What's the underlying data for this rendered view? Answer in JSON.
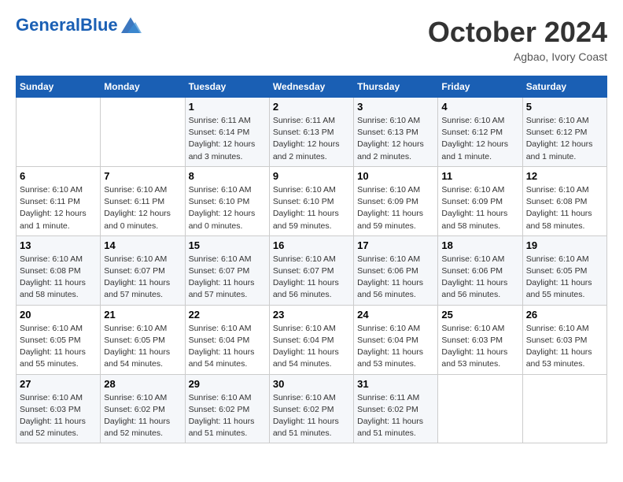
{
  "header": {
    "logo_general": "General",
    "logo_blue": "Blue",
    "month_title": "October 2024",
    "location": "Agbao, Ivory Coast"
  },
  "weekdays": [
    "Sunday",
    "Monday",
    "Tuesday",
    "Wednesday",
    "Thursday",
    "Friday",
    "Saturday"
  ],
  "weeks": [
    [
      {
        "day": "",
        "info": ""
      },
      {
        "day": "",
        "info": ""
      },
      {
        "day": "1",
        "info": "Sunrise: 6:11 AM\nSunset: 6:14 PM\nDaylight: 12 hours and 3 minutes."
      },
      {
        "day": "2",
        "info": "Sunrise: 6:11 AM\nSunset: 6:13 PM\nDaylight: 12 hours and 2 minutes."
      },
      {
        "day": "3",
        "info": "Sunrise: 6:10 AM\nSunset: 6:13 PM\nDaylight: 12 hours and 2 minutes."
      },
      {
        "day": "4",
        "info": "Sunrise: 6:10 AM\nSunset: 6:12 PM\nDaylight: 12 hours and 1 minute."
      },
      {
        "day": "5",
        "info": "Sunrise: 6:10 AM\nSunset: 6:12 PM\nDaylight: 12 hours and 1 minute."
      }
    ],
    [
      {
        "day": "6",
        "info": "Sunrise: 6:10 AM\nSunset: 6:11 PM\nDaylight: 12 hours and 1 minute."
      },
      {
        "day": "7",
        "info": "Sunrise: 6:10 AM\nSunset: 6:11 PM\nDaylight: 12 hours and 0 minutes."
      },
      {
        "day": "8",
        "info": "Sunrise: 6:10 AM\nSunset: 6:10 PM\nDaylight: 12 hours and 0 minutes."
      },
      {
        "day": "9",
        "info": "Sunrise: 6:10 AM\nSunset: 6:10 PM\nDaylight: 11 hours and 59 minutes."
      },
      {
        "day": "10",
        "info": "Sunrise: 6:10 AM\nSunset: 6:09 PM\nDaylight: 11 hours and 59 minutes."
      },
      {
        "day": "11",
        "info": "Sunrise: 6:10 AM\nSunset: 6:09 PM\nDaylight: 11 hours and 58 minutes."
      },
      {
        "day": "12",
        "info": "Sunrise: 6:10 AM\nSunset: 6:08 PM\nDaylight: 11 hours and 58 minutes."
      }
    ],
    [
      {
        "day": "13",
        "info": "Sunrise: 6:10 AM\nSunset: 6:08 PM\nDaylight: 11 hours and 58 minutes."
      },
      {
        "day": "14",
        "info": "Sunrise: 6:10 AM\nSunset: 6:07 PM\nDaylight: 11 hours and 57 minutes."
      },
      {
        "day": "15",
        "info": "Sunrise: 6:10 AM\nSunset: 6:07 PM\nDaylight: 11 hours and 57 minutes."
      },
      {
        "day": "16",
        "info": "Sunrise: 6:10 AM\nSunset: 6:07 PM\nDaylight: 11 hours and 56 minutes."
      },
      {
        "day": "17",
        "info": "Sunrise: 6:10 AM\nSunset: 6:06 PM\nDaylight: 11 hours and 56 minutes."
      },
      {
        "day": "18",
        "info": "Sunrise: 6:10 AM\nSunset: 6:06 PM\nDaylight: 11 hours and 56 minutes."
      },
      {
        "day": "19",
        "info": "Sunrise: 6:10 AM\nSunset: 6:05 PM\nDaylight: 11 hours and 55 minutes."
      }
    ],
    [
      {
        "day": "20",
        "info": "Sunrise: 6:10 AM\nSunset: 6:05 PM\nDaylight: 11 hours and 55 minutes."
      },
      {
        "day": "21",
        "info": "Sunrise: 6:10 AM\nSunset: 6:05 PM\nDaylight: 11 hours and 54 minutes."
      },
      {
        "day": "22",
        "info": "Sunrise: 6:10 AM\nSunset: 6:04 PM\nDaylight: 11 hours and 54 minutes."
      },
      {
        "day": "23",
        "info": "Sunrise: 6:10 AM\nSunset: 6:04 PM\nDaylight: 11 hours and 54 minutes."
      },
      {
        "day": "24",
        "info": "Sunrise: 6:10 AM\nSunset: 6:04 PM\nDaylight: 11 hours and 53 minutes."
      },
      {
        "day": "25",
        "info": "Sunrise: 6:10 AM\nSunset: 6:03 PM\nDaylight: 11 hours and 53 minutes."
      },
      {
        "day": "26",
        "info": "Sunrise: 6:10 AM\nSunset: 6:03 PM\nDaylight: 11 hours and 53 minutes."
      }
    ],
    [
      {
        "day": "27",
        "info": "Sunrise: 6:10 AM\nSunset: 6:03 PM\nDaylight: 11 hours and 52 minutes."
      },
      {
        "day": "28",
        "info": "Sunrise: 6:10 AM\nSunset: 6:02 PM\nDaylight: 11 hours and 52 minutes."
      },
      {
        "day": "29",
        "info": "Sunrise: 6:10 AM\nSunset: 6:02 PM\nDaylight: 11 hours and 51 minutes."
      },
      {
        "day": "30",
        "info": "Sunrise: 6:10 AM\nSunset: 6:02 PM\nDaylight: 11 hours and 51 minutes."
      },
      {
        "day": "31",
        "info": "Sunrise: 6:11 AM\nSunset: 6:02 PM\nDaylight: 11 hours and 51 minutes."
      },
      {
        "day": "",
        "info": ""
      },
      {
        "day": "",
        "info": ""
      }
    ]
  ]
}
